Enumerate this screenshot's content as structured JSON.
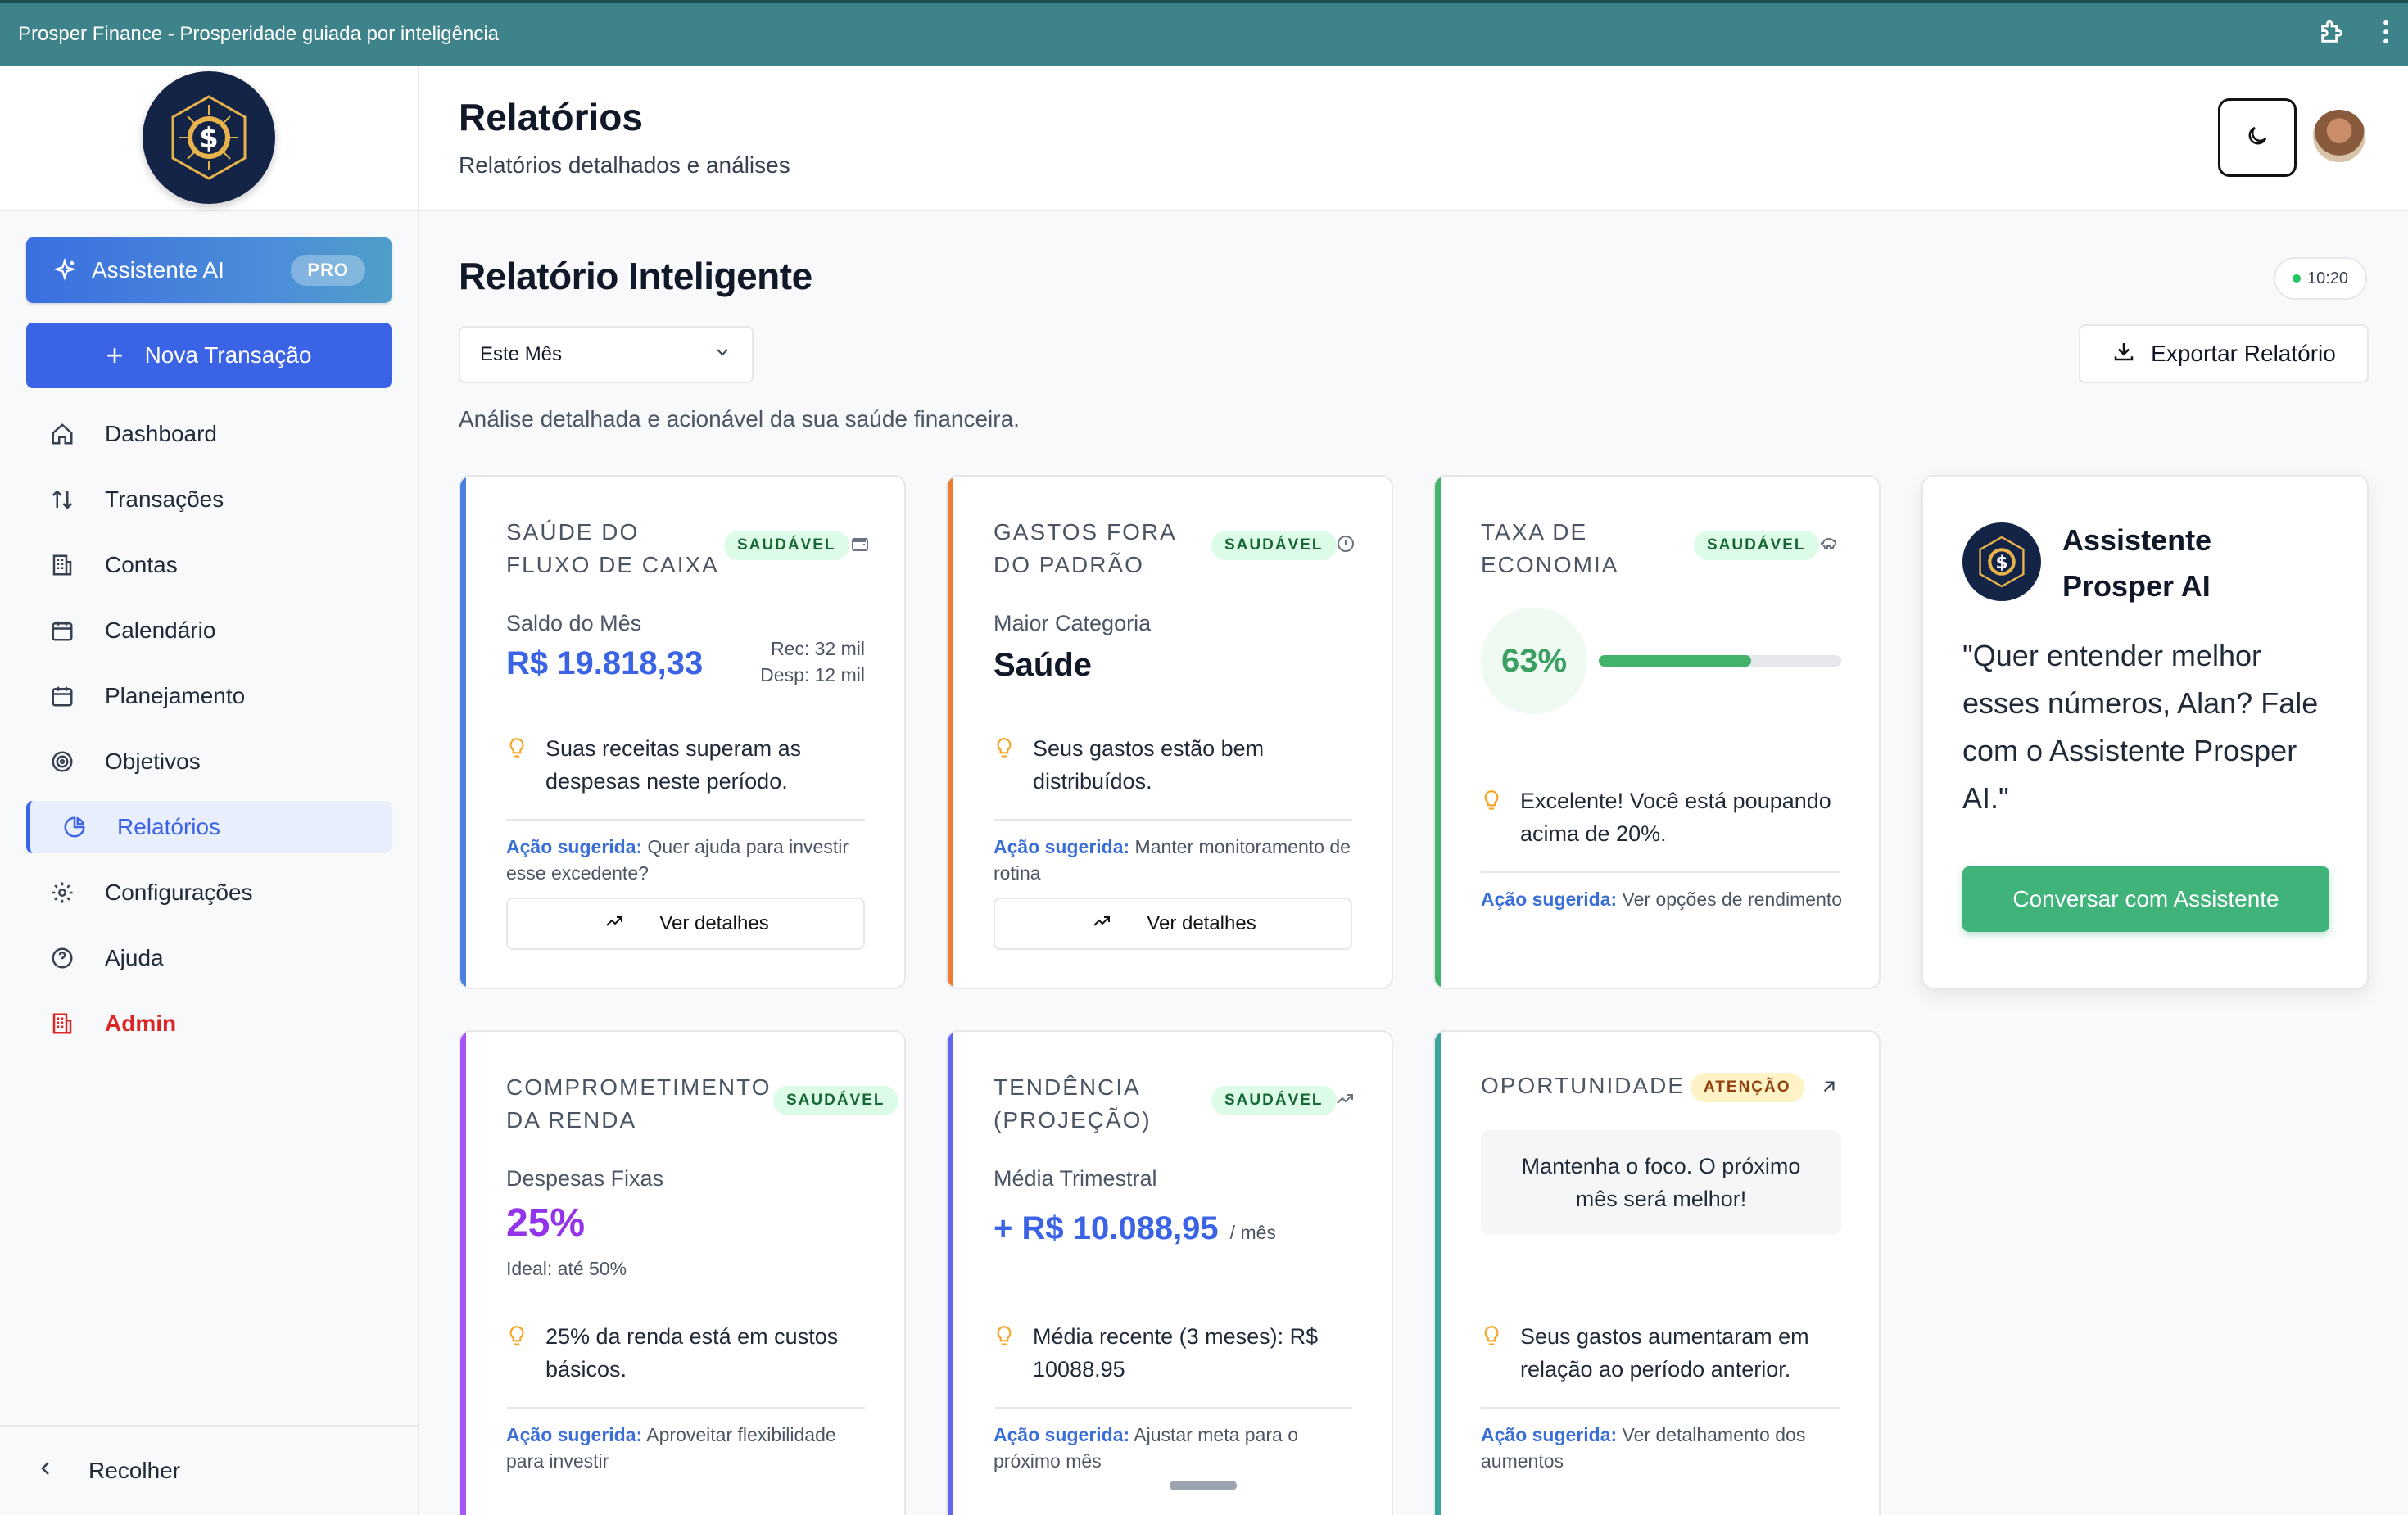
{
  "window": {
    "title": "Prosper Finance - Prosperidade guiada por inteligência"
  },
  "sidebar": {
    "ai_button": {
      "label": "Assistente AI",
      "badge": "PRO"
    },
    "new_button": {
      "label": "Nova Transação"
    },
    "items": [
      {
        "label": "Dashboard",
        "icon": "home-icon"
      },
      {
        "label": "Transações",
        "icon": "arrows-updown-icon"
      },
      {
        "label": "Contas",
        "icon": "building-icon"
      },
      {
        "label": "Calendário",
        "icon": "calendar-icon"
      },
      {
        "label": "Planejamento",
        "icon": "calendar-icon"
      },
      {
        "label": "Objetivos",
        "icon": "target-icon"
      },
      {
        "label": "Relatórios",
        "icon": "pie-chart-icon",
        "active": true
      },
      {
        "label": "Configurações",
        "icon": "gear-icon"
      },
      {
        "label": "Ajuda",
        "icon": "help-icon"
      },
      {
        "label": "Admin",
        "icon": "building-icon"
      }
    ],
    "collapse_label": "Recolher"
  },
  "header": {
    "title": "Relatórios",
    "subtitle": "Relatórios detalhados e análises"
  },
  "main": {
    "title": "Relatório Inteligente",
    "time": "10:20",
    "period_select": "Este Mês",
    "export_label": "Exportar Relatório",
    "description": "Análise detalhada e acionável da sua saúde financeira."
  },
  "cards": {
    "cashflow": {
      "title_1": "SAÚDE DO",
      "title_2": "FLUXO DE CAIXA",
      "badge": "SAUDÁVEL",
      "label": "Saldo do Mês",
      "value": "R$ 19.818,33",
      "rec": "Rec: 32 mil",
      "desp": "Desp: 12 mil",
      "tip": "Suas receitas superam as despesas neste período.",
      "action_label": "Ação sugerida:",
      "action": "Quer ajuda para investir esse excedente?",
      "details": "Ver detalhes"
    },
    "spending": {
      "title_1": "GASTOS FORA",
      "title_2": "DO PADRÃO",
      "badge": "SAUDÁVEL",
      "label": "Maior Categoria",
      "value": "Saúde",
      "tip": "Seus gastos estão bem distribuídos.",
      "action_label": "Ação sugerida:",
      "action": "Manter monitoramento de rotina",
      "details": "Ver detalhes"
    },
    "savings": {
      "title_1": "TAXA DE",
      "title_2": "ECONOMIA",
      "badge": "SAUDÁVEL",
      "value": "63%",
      "progress": 0.63,
      "tip": "Excelente! Você está poupando acima de 20%.",
      "action_label": "Ação sugerida:",
      "action": "Ver opções de rendimento"
    },
    "commitment": {
      "title_1": "COMPROMETIMENTO",
      "title_2": "DA RENDA",
      "badge": "SAUDÁVEL",
      "label": "Despesas Fixas",
      "value": "25%",
      "ideal": "Ideal: até 50%",
      "tip": "25% da renda está em custos básicos.",
      "action_label": "Ação sugerida:",
      "action": "Aproveitar flexibilidade para investir"
    },
    "trend": {
      "title_1": "TENDÊNCIA",
      "title_2": "(PROJEÇÃO)",
      "badge": "SAUDÁVEL",
      "label": "Média Trimestral",
      "value": "+ R$ 10.088,95",
      "unit": "/ mês",
      "tip": "Média recente (3 meses): R$ 10088.95",
      "action_label": "Ação sugerida:",
      "action": "Ajustar meta para o próximo mês"
    },
    "opportunity": {
      "title_1": "OPORTUNIDADE",
      "badge": "ATENÇÃO",
      "message": "Mantenha o foco. O próximo mês será melhor!",
      "tip": "Seus gastos aumentaram em relação ao período anterior.",
      "action_label": "Ação sugerida:",
      "action": "Ver detalhamento dos aumentos"
    }
  },
  "assistant": {
    "name": "Assistente Prosper AI",
    "quote": "\"Quer entender melhor esses números, Alan? Fale com o Assistente Prosper AI.\"",
    "button": "Conversar com Assistente"
  },
  "colors": {
    "titlebar": "#3d8389",
    "primary": "#3b63e6",
    "green": "#3fb37a",
    "blue_bar": "#4a7fe0",
    "orange_bar": "#f07a2f",
    "green_bar": "#43b36b",
    "purple_bar": "#a855f7",
    "indigo_bar": "#6366f1",
    "teal_bar": "#3aa39b"
  }
}
